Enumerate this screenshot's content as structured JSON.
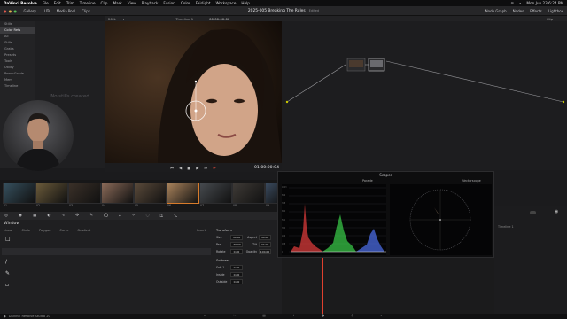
{
  "menubar": {
    "app": "DaVinci Resolve",
    "items": [
      "File",
      "Edit",
      "Trim",
      "Timeline",
      "Clip",
      "Mark",
      "View",
      "Playback",
      "Fusion",
      "Color",
      "Fairlight",
      "Workspace",
      "Help"
    ],
    "clock": "Mon Jun 23 6:24 PM"
  },
  "toolbar": {
    "left": [
      "Gallery",
      "LUTs",
      "Media Pool",
      "Clips"
    ],
    "project_title": "2025-005 Breaking The Rules",
    "edited": "Edited",
    "right": [
      "Node Graph",
      "Nodes",
      "Effects",
      "Lightbox"
    ]
  },
  "viewer": {
    "zoom": "26%",
    "timeline_name": "Timeline 1",
    "timecode_top": "00:00:00:00",
    "timecode": "01:00:00:04",
    "clip_label": "Clip"
  },
  "sidebar": {
    "items": [
      "Stills",
      "Color Refs",
      "All",
      "Stills",
      "Grabs",
      "Presets",
      "Tools",
      "Utility",
      "PowerGrade",
      "Mem",
      "Timeline"
    ],
    "selected": 1
  },
  "stills": {
    "message": "No stills created"
  },
  "clips": {
    "numbers": [
      "01",
      "02",
      "03",
      "04",
      "05",
      "06",
      "07",
      "08",
      "09"
    ],
    "selected": 5,
    "tints": [
      "#36505e",
      "#6a5a3a",
      "#3a3028",
      "#8a6a58",
      "#5a4a3a",
      "#a8825a",
      "#464a4e",
      "#3e3a36",
      "#3a4a5e"
    ]
  },
  "window_panel": {
    "title": "Window",
    "tabs": [
      "Linear",
      "Circle",
      "Polygon",
      "Curve",
      "Gradient"
    ],
    "section_transform": "Transform",
    "section_softness": "Softness",
    "transform_rows": [
      {
        "label": "Size",
        "value": "50.00",
        "label2": "Aspect",
        "value2": "50.00"
      },
      {
        "label": "Pan",
        "value": "-40.00",
        "label2": "Tilt",
        "value2": "22.00"
      },
      {
        "label": "Rotate",
        "value": "0.00",
        "label2": "Opacity",
        "value2": "100.00"
      }
    ],
    "softness_rows": [
      {
        "label": "Soft 1",
        "value": "0.00"
      },
      {
        "label": "Inside",
        "value": "0.00"
      },
      {
        "label": "Outside",
        "value": "0.00"
      }
    ],
    "invert_label": "Invert"
  },
  "scopes": {
    "title": "Scopes",
    "left_label": "Parade",
    "right_label": "Vectorscope",
    "y_ticks": [
      "1023",
      "896",
      "768",
      "640",
      "512",
      "384",
      "256",
      "128",
      "0"
    ]
  },
  "timeline": {
    "track": "Timeline 1"
  },
  "bottom": {
    "label": "DaVinci Resolve Studio 20"
  },
  "page_tabs": [
    "media",
    "cut",
    "edit",
    "fusion",
    "color",
    "fairlight",
    "deliver"
  ]
}
